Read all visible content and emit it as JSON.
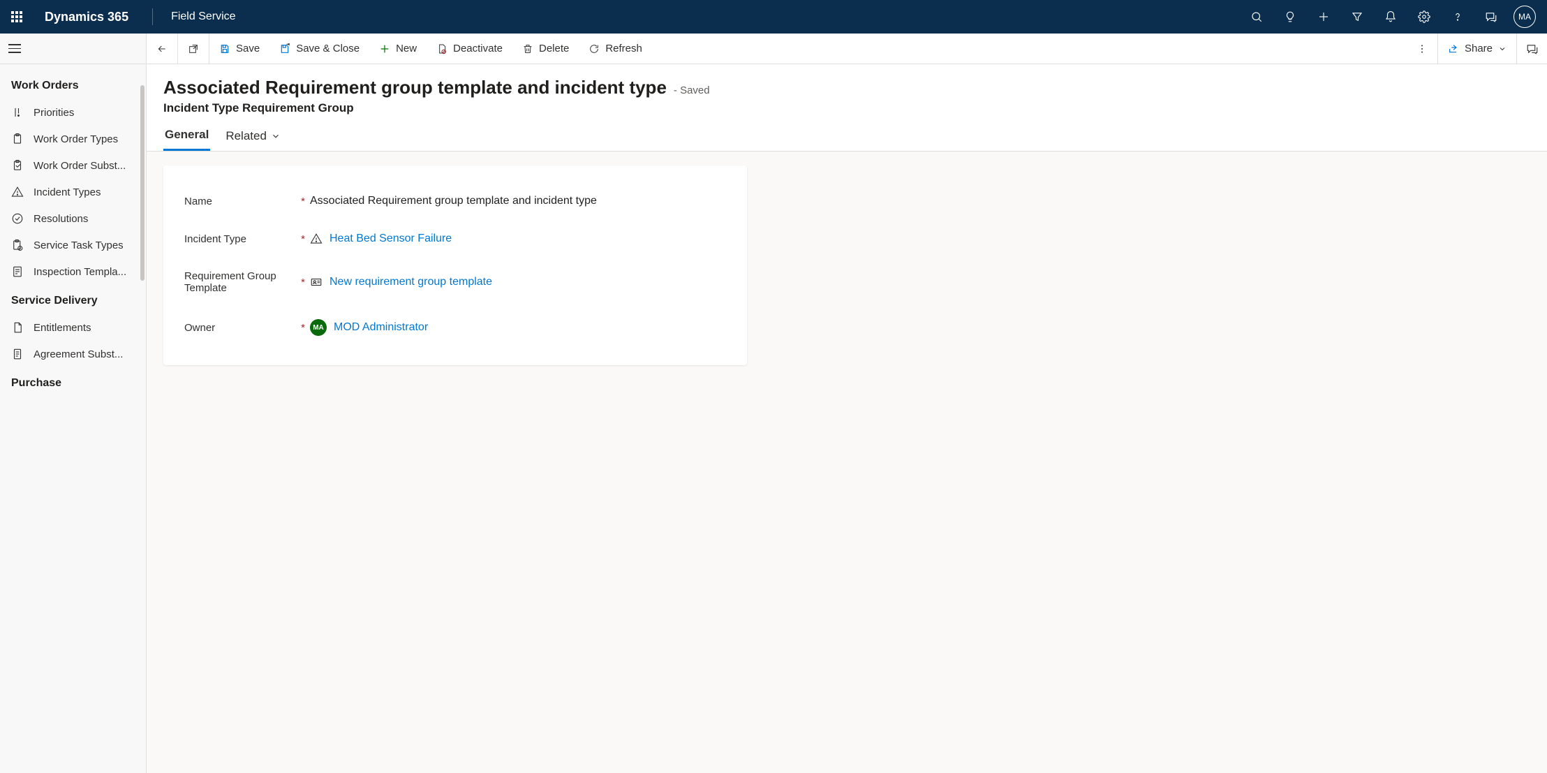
{
  "topbar": {
    "brand": "Dynamics 365",
    "app": "Field Service",
    "avatar": "MA"
  },
  "leftnav": {
    "groups": [
      {
        "title": "Work Orders",
        "items": [
          {
            "label": "Priorities"
          },
          {
            "label": "Work Order Types"
          },
          {
            "label": "Work Order Subst..."
          },
          {
            "label": "Incident Types"
          },
          {
            "label": "Resolutions"
          },
          {
            "label": "Service Task Types"
          },
          {
            "label": "Inspection Templa..."
          }
        ]
      },
      {
        "title": "Service Delivery",
        "items": [
          {
            "label": "Entitlements"
          },
          {
            "label": "Agreement Subst..."
          }
        ]
      },
      {
        "title": "Purchase",
        "items": []
      }
    ]
  },
  "cmdbar": {
    "save": "Save",
    "save_close": "Save & Close",
    "new": "New",
    "deactivate": "Deactivate",
    "delete": "Delete",
    "refresh": "Refresh",
    "share": "Share"
  },
  "form": {
    "title": "Associated Requirement group template and incident type",
    "status": "- Saved",
    "subtitle": "Incident Type Requirement Group",
    "tabs": {
      "general": "General",
      "related": "Related"
    },
    "fields": {
      "name": {
        "label": "Name",
        "value": "Associated Requirement group template and incident type"
      },
      "incident_type": {
        "label": "Incident Type",
        "value": "Heat Bed Sensor Failure"
      },
      "req_group_template": {
        "label": "Requirement Group Template",
        "value": "New requirement group template"
      },
      "owner": {
        "label": "Owner",
        "value": "MOD Administrator",
        "initials": "MA"
      }
    }
  }
}
